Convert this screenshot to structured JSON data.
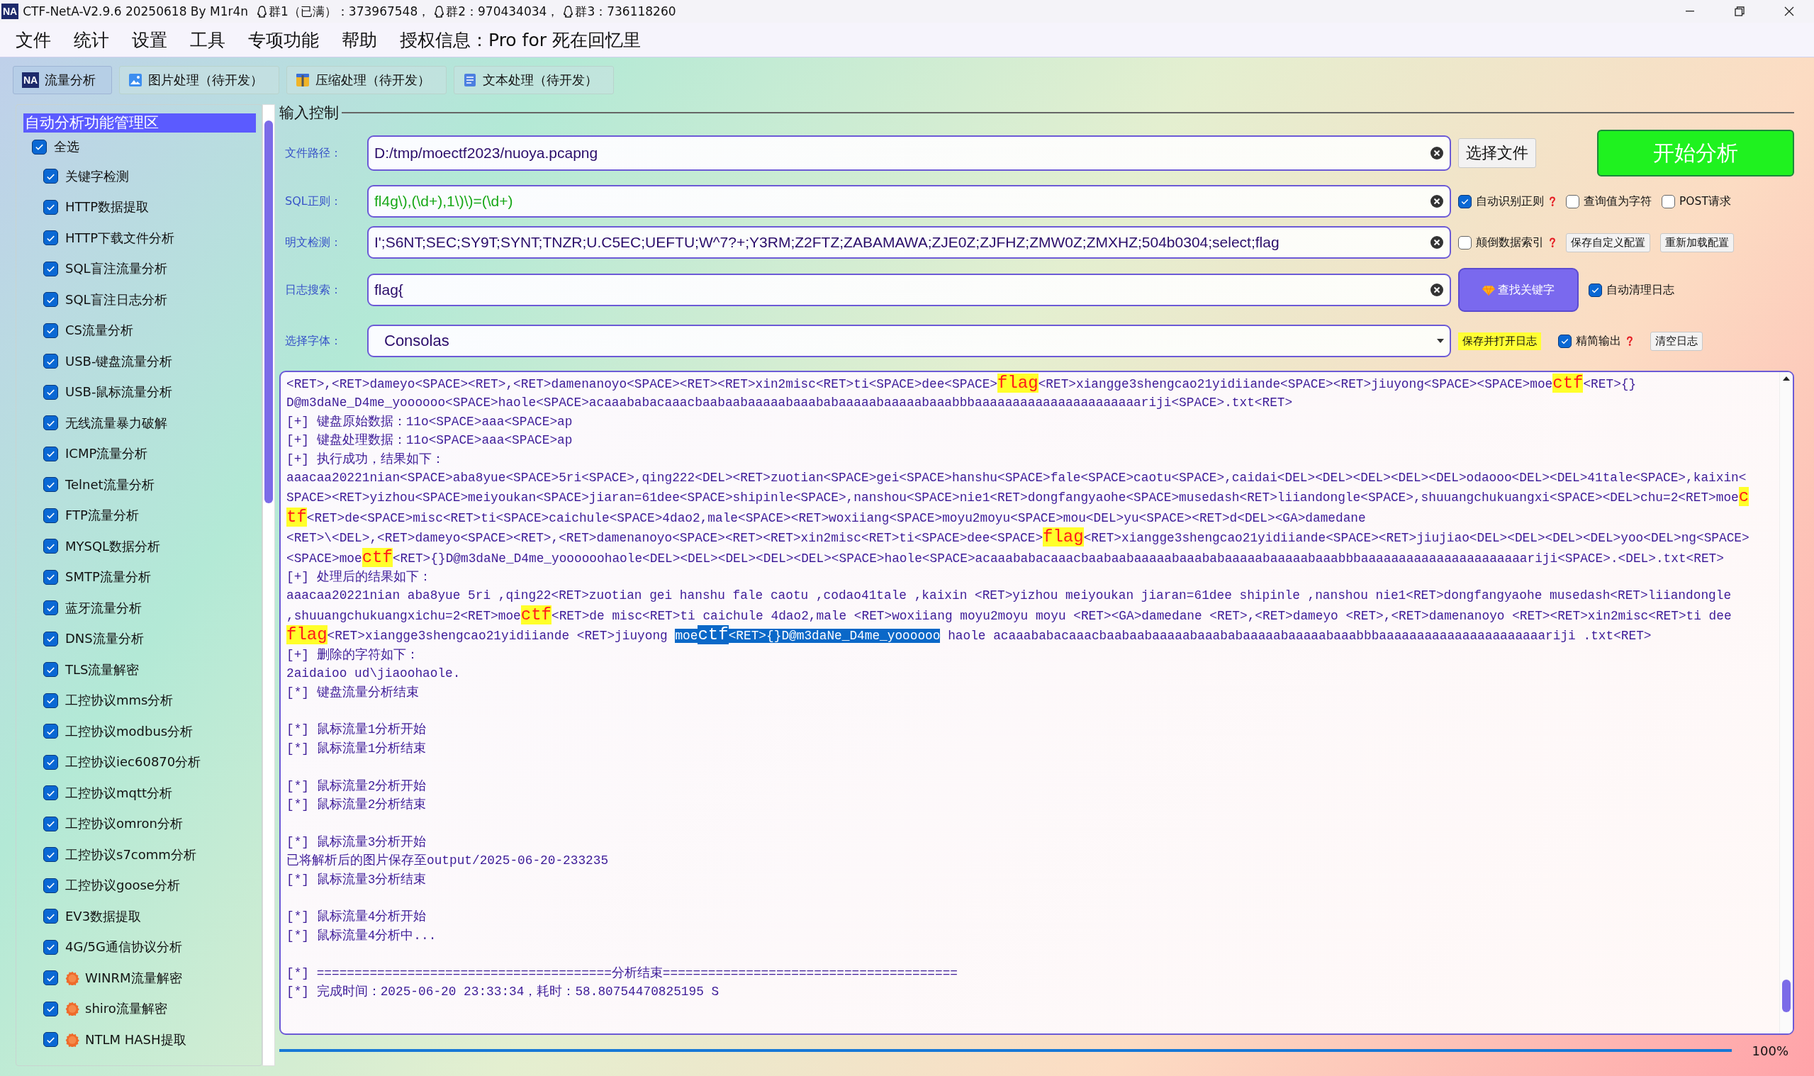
{
  "window": {
    "logo": "NA",
    "title": "CTF-NetA-V2.9.6 20250618 By M1r4n",
    "groups": [
      "群1（已满）：373967548，",
      "群2：970434034，",
      "群3：736118260"
    ]
  },
  "menu": [
    "文件",
    "统计",
    "设置",
    "工具",
    "专项功能",
    "帮助",
    "授权信息：Pro for 死在回忆里"
  ],
  "tabs": [
    {
      "kind": "logo",
      "logo": "NA",
      "label": "流量分析",
      "selected": true
    },
    {
      "kind": "image",
      "label": "图片处理（待开发）",
      "selected": false
    },
    {
      "kind": "archive",
      "label": "压缩处理（待开发）",
      "selected": false
    },
    {
      "kind": "document",
      "label": "文本处理（待开发）",
      "selected": false
    }
  ],
  "sidebar": {
    "title": "自动分析功能管理区",
    "select_all": {
      "label": "全选",
      "checked": true
    },
    "items": [
      {
        "label": "关键字检测",
        "checked": true,
        "new": false
      },
      {
        "label": "HTTP数据提取",
        "checked": true,
        "new": false
      },
      {
        "label": "HTTP下载文件分析",
        "checked": true,
        "new": false
      },
      {
        "label": "SQL盲注流量分析",
        "checked": true,
        "new": false
      },
      {
        "label": "SQL盲注日志分析",
        "checked": true,
        "new": false
      },
      {
        "label": "CS流量分析",
        "checked": true,
        "new": false
      },
      {
        "label": "USB-键盘流量分析",
        "checked": true,
        "new": false
      },
      {
        "label": "USB-鼠标流量分析",
        "checked": true,
        "new": false
      },
      {
        "label": "无线流量暴力破解",
        "checked": true,
        "new": false
      },
      {
        "label": "ICMP流量分析",
        "checked": true,
        "new": false
      },
      {
        "label": "Telnet流量分析",
        "checked": true,
        "new": false
      },
      {
        "label": "FTP流量分析",
        "checked": true,
        "new": false
      },
      {
        "label": "MYSQL数据分析",
        "checked": true,
        "new": false
      },
      {
        "label": "SMTP流量分析",
        "checked": true,
        "new": false
      },
      {
        "label": "蓝牙流量分析",
        "checked": true,
        "new": false
      },
      {
        "label": "DNS流量分析",
        "checked": true,
        "new": false
      },
      {
        "label": "TLS流量解密",
        "checked": true,
        "new": false
      },
      {
        "label": "工控协议mms分析",
        "checked": true,
        "new": false
      },
      {
        "label": "工控协议modbus分析",
        "checked": true,
        "new": false
      },
      {
        "label": "工控协议iec60870分析",
        "checked": true,
        "new": false
      },
      {
        "label": "工控协议mqtt分析",
        "checked": true,
        "new": false
      },
      {
        "label": "工控协议omron分析",
        "checked": true,
        "new": false
      },
      {
        "label": "工控协议s7comm分析",
        "checked": true,
        "new": false
      },
      {
        "label": "工控协议goose分析",
        "checked": true,
        "new": false
      },
      {
        "label": "EV3数据提取",
        "checked": true,
        "new": false
      },
      {
        "label": "4G/5G通信协议分析",
        "checked": true,
        "new": false
      },
      {
        "label": "WINRM流量解密",
        "checked": true,
        "new": true
      },
      {
        "label": "shiro流量解密",
        "checked": true,
        "new": true
      },
      {
        "label": "NTLM HASH提取",
        "checked": true,
        "new": true
      }
    ]
  },
  "input_control": {
    "title": "输入控制",
    "rows": [
      {
        "kind": "file",
        "label": "文件路径：",
        "value": "D:/tmp/moectf2023/nuoya.pcapng",
        "controls": [
          {
            "kind": "button",
            "label": "选择文件"
          },
          {
            "kind": "start",
            "label": "开始分析"
          }
        ]
      },
      {
        "kind": "regex",
        "label": "SQL正则：",
        "value": "fl4g\\),(\\d+),1\\)\\)=(\\d+)",
        "controls": [
          {
            "kind": "checkbox",
            "label": "自动识别正则",
            "checked": true,
            "help": true
          },
          {
            "kind": "checkbox",
            "label": "查询值为字符",
            "checked": false,
            "help": false
          },
          {
            "kind": "checkbox",
            "label": "POST请求",
            "checked": false,
            "help": false
          }
        ]
      },
      {
        "kind": "plain",
        "label": "明文检测：",
        "value": "I';S6NT;SEC;SY9T;SYNT;TNZR;U.C5EC;UEFTU;W^7?+;Y3RM;Z2FTZ;ZABAMAWA;ZJE0Z;ZJFHZ;ZMW0Z;ZMXHZ;504b0304;select;flag",
        "controls": [
          {
            "kind": "checkbox",
            "label": "颠倒数据索引",
            "checked": false,
            "help": true
          },
          {
            "kind": "button",
            "label": "保存自定义配置"
          },
          {
            "kind": "button",
            "label": "重新加载配置"
          }
        ]
      },
      {
        "kind": "search",
        "label": "日志搜索：",
        "value": "flag{",
        "controls": [
          {
            "kind": "search",
            "label": "查找关键字"
          },
          {
            "kind": "checkbox",
            "label": "自动清理日志",
            "checked": true,
            "help": false
          }
        ]
      },
      {
        "kind": "font",
        "label": "选择字体：",
        "value": "Consolas",
        "controls": [
          {
            "kind": "marked",
            "label": "保存并打开日志"
          },
          {
            "kind": "checkbox",
            "label": "精简输出",
            "checked": true,
            "help": true
          },
          {
            "kind": "button",
            "label": "清空日志"
          }
        ]
      }
    ]
  },
  "log": {
    "lines": [
      {
        "kind": "text",
        "segments": [
          {
            "kind": "plain",
            "selected": false,
            "text": "<RET>,<RET>dameyo<SPACE><RET>,<RET>damenanoyo<SPACE><RET><RET>xin2misc<RET>ti<SPACE>dee<SPACE>"
          },
          {
            "kind": "keyword",
            "selected": false,
            "text": "flag"
          },
          {
            "kind": "plain",
            "selected": false,
            "text": "<RET>xiangge3shengcao21yidiiande<SPACE><RET>jiuyong<SPACE><SPACE>moe"
          },
          {
            "kind": "keyword",
            "selected": false,
            "text": "ctf"
          },
          {
            "kind": "plain",
            "selected": false,
            "text": "<RET>{}"
          }
        ]
      },
      {
        "kind": "text",
        "segments": [
          {
            "kind": "plain",
            "selected": false,
            "text": "D@m3daNe_D4me_yoooooo<SPACE>haole<SPACE>acaaababacaaacbaabaabaaaaabaaababaaaaabaaaaabaaabbbaaaaaaaaaaaaaaaaaaaaaariji<SPACE>.txt<RET>"
          }
        ]
      },
      {
        "kind": "text",
        "segments": [
          {
            "kind": "plain",
            "selected": false,
            "text": "[+] 键盘原始数据：11o<SPACE>aaa<SPACE>ap"
          }
        ]
      },
      {
        "kind": "text",
        "segments": [
          {
            "kind": "plain",
            "selected": false,
            "text": "[+] 键盘处理数据：11o<SPACE>aaa<SPACE>ap"
          }
        ]
      },
      {
        "kind": "text",
        "segments": [
          {
            "kind": "plain",
            "selected": false,
            "text": "[+] 执行成功，结果如下："
          }
        ]
      },
      {
        "kind": "text",
        "segments": [
          {
            "kind": "plain",
            "selected": false,
            "text": "aaacaa20221nian<SPACE>aba8yue<SPACE>5ri<SPACE>,qing222<DEL><RET>zuotian<SPACE>gei<SPACE>hanshu<SPACE>fale<SPACE>caotu<SPACE>,caidai<DEL><DEL><DEL><DEL><DEL>odaooo<DEL><DEL>41tale<SPACE>,kaixin<"
          }
        ]
      },
      {
        "kind": "text",
        "segments": [
          {
            "kind": "plain",
            "selected": false,
            "text": "SPACE><RET>yizhou<SPACE>meiyoukan<SPACE>jiaran=61dee<SPACE>shipinle<SPACE>,nanshou<SPACE>nie1<RET>dongfangyaohe<SPACE>musedash<RET>liiandongle<SPACE>,shuuangchukuangxi<SPACE><DEL>chu=2<RET>moe"
          },
          {
            "kind": "keyword",
            "selected": false,
            "text": "c"
          }
        ]
      },
      {
        "kind": "text",
        "segments": [
          {
            "kind": "keyword",
            "selected": false,
            "text": "tf"
          },
          {
            "kind": "plain",
            "selected": false,
            "text": "<RET>de<SPACE>misc<RET>ti<SPACE>caichule<SPACE>4dao2,male<SPACE><RET>woxiiang<SPACE>moyu2moyu<SPACE>mou<DEL>yu<SPACE><RET>d<DEL><GA>damedane"
          }
        ]
      },
      {
        "kind": "text",
        "segments": [
          {
            "kind": "plain",
            "selected": false,
            "text": "<RET>\\<DEL>,<RET>dameyo<SPACE><RET>,<RET>damenanoyo<SPACE><RET><RET>xin2misc<RET>ti<SPACE>dee<SPACE>"
          },
          {
            "kind": "keyword",
            "selected": false,
            "text": "flag"
          },
          {
            "kind": "plain",
            "selected": false,
            "text": "<RET>xiangge3shengcao21yidiiande<SPACE><RET>jiujiao<DEL><DEL><DEL><DEL>yoo<DEL>ng<SPACE>"
          }
        ]
      },
      {
        "kind": "text",
        "segments": [
          {
            "kind": "plain",
            "selected": false,
            "text": "<SPACE>moe"
          },
          {
            "kind": "keyword",
            "selected": false,
            "text": "ctf"
          },
          {
            "kind": "plain",
            "selected": false,
            "text": "<RET>{}D@m3daNe_D4me_yoooooohaole<DEL><DEL><DEL><DEL><DEL><SPACE>haole<SPACE>acaaababacaaacbaabaabaaaaabaaababaaaaabaaaaabaaabbbaaaaaaaaaaaaaaaaaaaaaariji<SPACE>.<DEL>.txt<RET>"
          }
        ]
      },
      {
        "kind": "text",
        "segments": [
          {
            "kind": "plain",
            "selected": false,
            "text": "[+] 处理后的结果如下："
          }
        ]
      },
      {
        "kind": "text",
        "segments": [
          {
            "kind": "plain",
            "selected": false,
            "text": "aaacaa20221nian aba8yue 5ri ,qing22<RET>zuotian gei hanshu fale caotu ,codao41tale ,kaixin <RET>yizhou meiyoukan jiaran=61dee shipinle ,nanshou nie1<RET>dongfangyaohe musedash<RET>liiandongle"
          }
        ]
      },
      {
        "kind": "text",
        "segments": [
          {
            "kind": "plain",
            "selected": false,
            "text": ",shuuangchukuangxichu=2<RET>moe"
          },
          {
            "kind": "keyword",
            "selected": false,
            "text": "ctf"
          },
          {
            "kind": "plain",
            "selected": false,
            "text": "<RET>de misc<RET>ti caichule 4dao2,male <RET>woxiiang moyu2moyu moyu <RET><GA>damedane <RET>,<RET>dameyo <RET>,<RET>damenanoyo <RET><RET>xin2misc<RET>ti dee"
          }
        ]
      },
      {
        "kind": "text",
        "segments": [
          {
            "kind": "keyword",
            "selected": false,
            "text": "flag"
          },
          {
            "kind": "plain",
            "selected": false,
            "text": "<RET>xiangge3shengcao21yidiiande <RET>jiuyong "
          },
          {
            "kind": "plain",
            "selected": true,
            "text": "moe"
          },
          {
            "kind": "keyword",
            "selected": true,
            "text": "ctf"
          },
          {
            "kind": "plain",
            "selected": true,
            "text": "<RET>{}D@m3daNe_D4me_yoooooo"
          },
          {
            "kind": "plain",
            "selected": false,
            "text": " haole acaaababacaaacbaabaabaaaaabaaababaaaaabaaaaabaaabbbaaaaaaaaaaaaaaaaaaaaaariji .txt<RET>"
          }
        ]
      },
      {
        "kind": "text",
        "segments": [
          {
            "kind": "plain",
            "selected": false,
            "text": "[+] 删除的字符如下："
          }
        ]
      },
      {
        "kind": "text",
        "segments": [
          {
            "kind": "plain",
            "selected": false,
            "text": "2aidaioo ud\\jiaoohaole."
          }
        ]
      },
      {
        "kind": "text",
        "segments": [
          {
            "kind": "plain",
            "selected": false,
            "text": "[*] 键盘流量分析结束"
          }
        ]
      },
      {
        "kind": "blank"
      },
      {
        "kind": "text",
        "segments": [
          {
            "kind": "plain",
            "selected": false,
            "text": "[*] 鼠标流量1分析开始"
          }
        ]
      },
      {
        "kind": "text",
        "segments": [
          {
            "kind": "plain",
            "selected": false,
            "text": "[*] 鼠标流量1分析结束"
          }
        ]
      },
      {
        "kind": "blank"
      },
      {
        "kind": "text",
        "segments": [
          {
            "kind": "plain",
            "selected": false,
            "text": "[*] 鼠标流量2分析开始"
          }
        ]
      },
      {
        "kind": "text",
        "segments": [
          {
            "kind": "plain",
            "selected": false,
            "text": "[*] 鼠标流量2分析结束"
          }
        ]
      },
      {
        "kind": "blank"
      },
      {
        "kind": "text",
        "segments": [
          {
            "kind": "plain",
            "selected": false,
            "text": "[*] 鼠标流量3分析开始"
          }
        ]
      },
      {
        "kind": "text",
        "segments": [
          {
            "kind": "plain",
            "selected": false,
            "text": "已将解析后的图片保存至output/2025-06-20-233235"
          }
        ]
      },
      {
        "kind": "text",
        "segments": [
          {
            "kind": "plain",
            "selected": false,
            "text": "[*] 鼠标流量3分析结束"
          }
        ]
      },
      {
        "kind": "blank"
      },
      {
        "kind": "text",
        "segments": [
          {
            "kind": "plain",
            "selected": false,
            "text": "[*] 鼠标流量4分析开始"
          }
        ]
      },
      {
        "kind": "text",
        "segments": [
          {
            "kind": "plain",
            "selected": false,
            "text": "[*] 鼠标流量4分析中..."
          }
        ]
      },
      {
        "kind": "blank"
      },
      {
        "kind": "text",
        "segments": [
          {
            "kind": "plain",
            "selected": false,
            "text": "[*] =======================================分析结束======================================="
          }
        ]
      },
      {
        "kind": "text",
        "segments": [
          {
            "kind": "plain",
            "selected": false,
            "text": "[*] 完成时间：2025-06-20 23:33:34，耗时：58.80754470825195 S"
          }
        ]
      }
    ]
  },
  "progress": {
    "level": 1,
    "reading": "100%"
  }
}
